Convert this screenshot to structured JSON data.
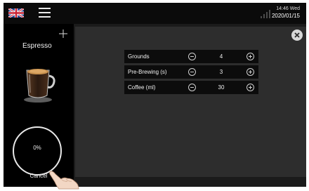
{
  "status_bar": {
    "language_flag_icon": "uk-flag-icon",
    "menu_icon": "hamburger-menu-icon",
    "signal_icon": "signal-strength-icon",
    "time": "14:46 Wed",
    "date": "2020/01/15"
  },
  "drink": {
    "name": "Espresso",
    "add_icon": "plus-icon",
    "image_icon": "espresso-cup-icon"
  },
  "progress": {
    "percent": 0,
    "label": "0%"
  },
  "actions": {
    "cancel_label": "Cancel",
    "close_icon": "close-icon"
  },
  "parameters": [
    {
      "label": "Grounds",
      "value": "4"
    },
    {
      "label": "Pre-Brewing (s)",
      "value": "3"
    },
    {
      "label": "Coffee (ml)",
      "value": "30"
    }
  ],
  "colors": {
    "screen_bg": "#1b1b1b",
    "panel_bg": "#2d2d2d",
    "row_bg": "#0c0c0c",
    "text": "#f0f0f0"
  }
}
